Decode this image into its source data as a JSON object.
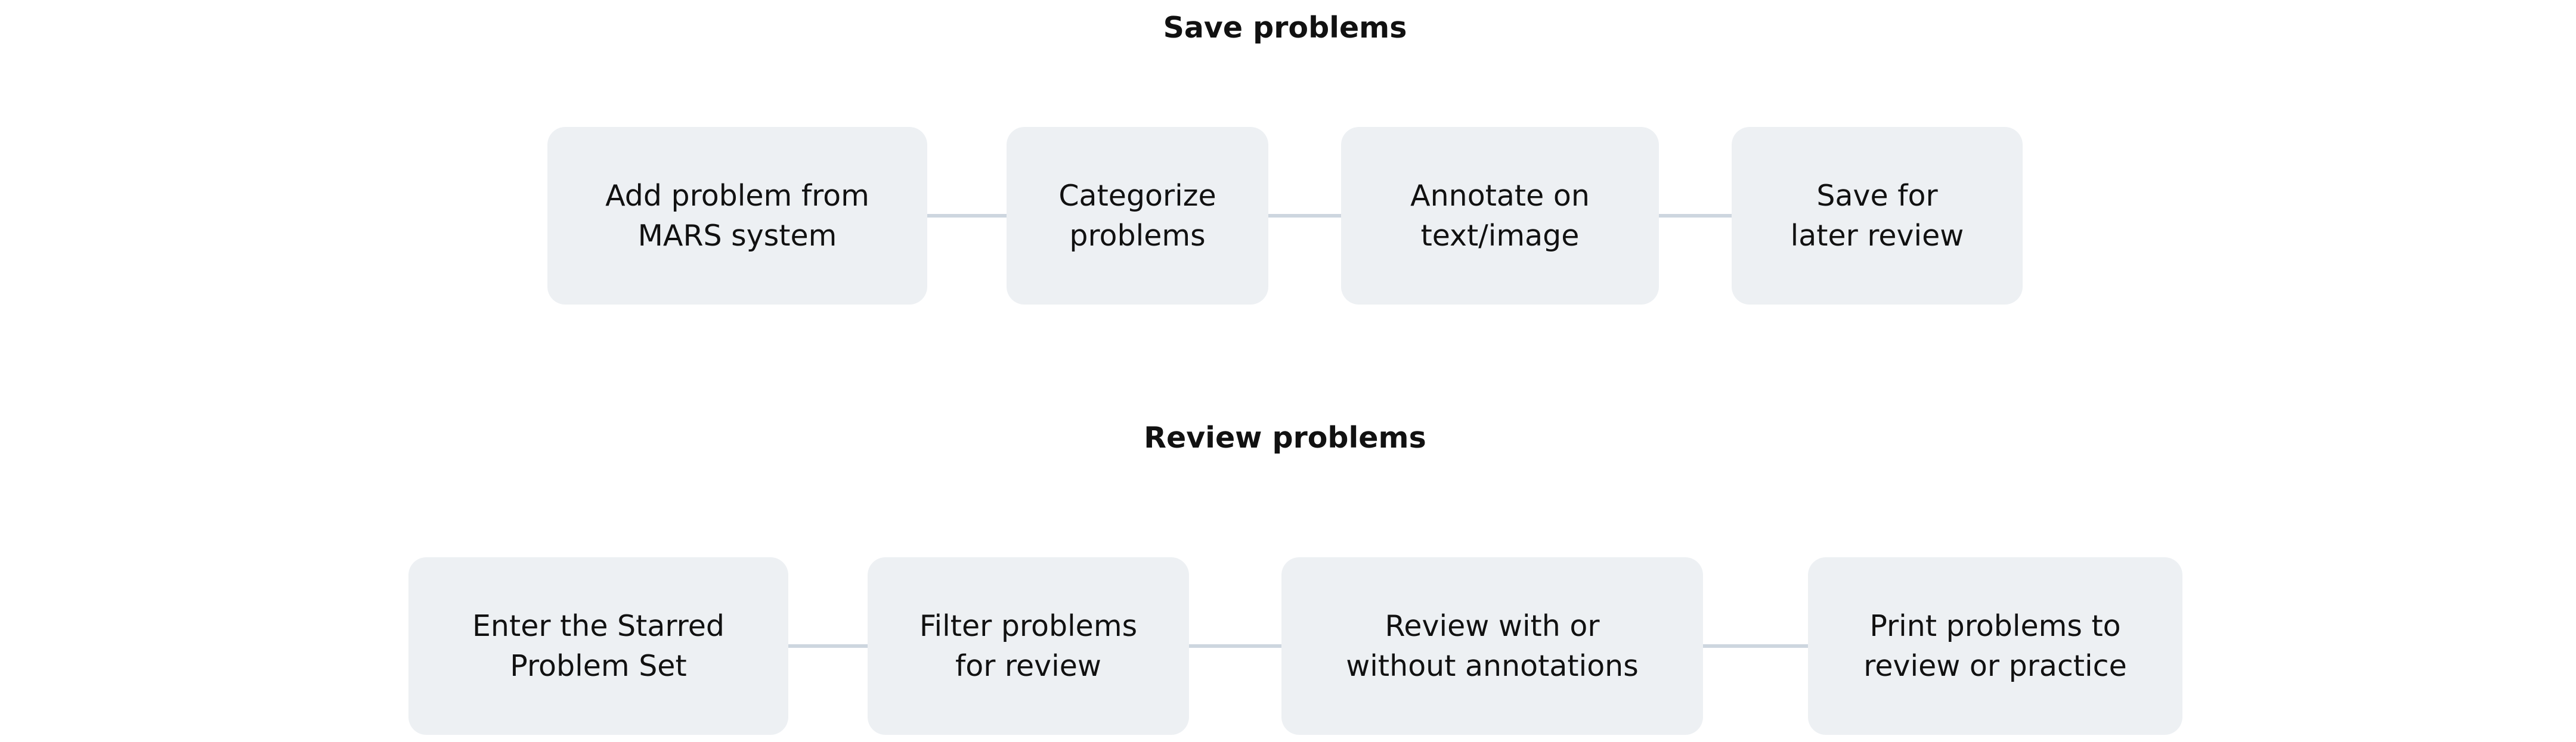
{
  "sections": [
    {
      "title": "Save problems",
      "steps": [
        "Add problem from\nMARS system",
        "Categorize\nproblems",
        "Annotate on\ntext/image",
        "Save for\nlater review"
      ]
    },
    {
      "title": "Review problems",
      "steps": [
        "Enter the Starred\nProblem Set",
        "Filter problems\nfor review",
        "Review with or\nwithout annotations",
        "Print problems to\nreview or practice"
      ]
    }
  ],
  "colors": {
    "step_background": "#edf0f3",
    "connector": "#cdd6df",
    "text": "#111111"
  }
}
